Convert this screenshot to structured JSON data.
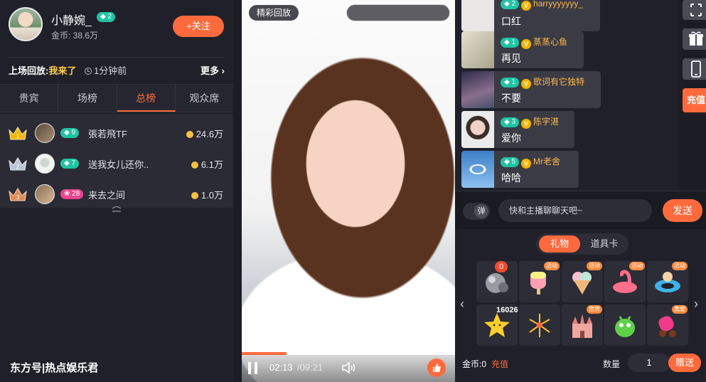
{
  "host": {
    "name": "小静婉_",
    "level": "2",
    "coins": "金币: 38.6万",
    "follow_label": "+关注"
  },
  "replay": {
    "label": "上场回放:",
    "link": "我来了",
    "time": "1分钟前",
    "more": "更多"
  },
  "tabs": [
    "贵宾",
    "场榜",
    "总榜",
    "观众席"
  ],
  "active_tab": "总榜",
  "ranking": [
    {
      "rank": 1,
      "level": "9",
      "name": "張若飛TF",
      "coins": "24.6万",
      "level_color": "#20c4a5",
      "crown_color": "#f5b400"
    },
    {
      "rank": 2,
      "level": "7",
      "name": "送我女儿还你..",
      "coins": "6.1万",
      "level_color": "#20c4a5",
      "crown_color": "#b9c3d6"
    },
    {
      "rank": 3,
      "level": "28",
      "name": "来去之间",
      "coins": "1.0万",
      "level_color": "#e8458f",
      "crown_color": "#e08a58"
    }
  ],
  "watermark": "东方号|热点娱乐君",
  "video": {
    "tag": "精彩回放",
    "current_time": "02:13",
    "total_time": "/09:21",
    "progress": 0.232
  },
  "chat": [
    {
      "level": "2",
      "user": "harryyyyyyy_",
      "text": "口红",
      "avatar_bg": "#e9e6e6"
    },
    {
      "level": "1",
      "user": "蒸蒸心鱼",
      "text": "再见",
      "avatar_bg": "#c9c0a6"
    },
    {
      "level": "1",
      "user": "歌词有它独特",
      "text": "不要",
      "avatar_bg": "#6e5a7a"
    },
    {
      "level": "3",
      "user": "陈宇湛",
      "text": "爱你",
      "avatar_bg": "#ece8e8"
    },
    {
      "level": "5",
      "user": "Mr老舍",
      "text": "哈哈",
      "avatar_bg": "#5d97d8"
    }
  ],
  "chat_input": {
    "toggle_label": "弹",
    "placeholder": "快和主播聊聊天吧~",
    "send_label": "发送"
  },
  "side": {
    "recharge_label": "充值"
  },
  "gifts": {
    "tabs": [
      "礼物",
      "道具卡"
    ],
    "active_tab": "礼物",
    "items": [
      {
        "badge": "",
        "count": "0",
        "art": "#8e8e96"
      },
      {
        "badge": "活动",
        "count": "",
        "art": "#ff9fb5"
      },
      {
        "badge": "活动",
        "count": "",
        "art": "#f7c0d4"
      },
      {
        "badge": "活动",
        "count": "",
        "art": "#ff6f8a"
      },
      {
        "badge": "活动",
        "count": "",
        "art": "#3fb2e8"
      },
      {
        "badge": "",
        "count": "16026",
        "art": "#ffd02b"
      },
      {
        "badge": "",
        "count": "",
        "art": "#ffbf3a"
      },
      {
        "badge": "世界",
        "count": "",
        "art": "#f2a6a0"
      },
      {
        "badge": "",
        "count": "",
        "art": "#5fd04a"
      },
      {
        "badge": "真爱",
        "count": "",
        "art": "#f13b8a"
      }
    ],
    "wallet_label": "金币:0",
    "recharge_label": "充值",
    "qty_label": "数量",
    "qty_value": "1",
    "give_label": "赠送"
  }
}
